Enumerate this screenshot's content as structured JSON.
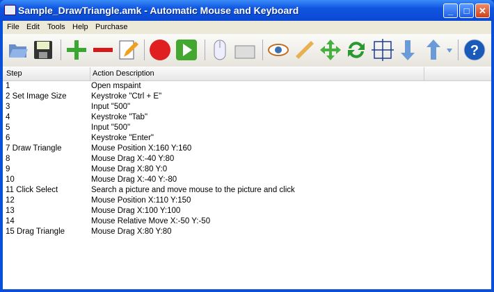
{
  "title": "Sample_DrawTriangle.amk - Automatic Mouse and Keyboard",
  "menu": [
    "File",
    "Edit",
    "Tools",
    "Help",
    "Purchase"
  ],
  "columns": {
    "step": "Step",
    "action": "Action Description"
  },
  "rows": [
    {
      "step": "1",
      "action": "Open mspaint"
    },
    {
      "step": "2  Set Image Size",
      "action": "Keystroke \"Ctrl + E\""
    },
    {
      "step": "3",
      "action": "Input \"500\""
    },
    {
      "step": "4",
      "action": "Keystroke \"Tab\""
    },
    {
      "step": "5",
      "action": "Input \"500\""
    },
    {
      "step": "6",
      "action": "Keystroke \"Enter\""
    },
    {
      "step": "7  Draw Triangle",
      "action": "Mouse Position X:160 Y:160"
    },
    {
      "step": "8",
      "action": "Mouse Drag X:-40 Y:80"
    },
    {
      "step": "9",
      "action": "Mouse Drag X:80 Y:0"
    },
    {
      "step": "10",
      "action": "Mouse Drag X:-40 Y:-80"
    },
    {
      "step": "11  Click Select",
      "action": "Search a picture and move mouse to the picture and click"
    },
    {
      "step": "12",
      "action": "Mouse Position X:110 Y:150"
    },
    {
      "step": "13",
      "action": "Mouse Drag X:100 Y:100"
    },
    {
      "step": "14",
      "action": "Mouse Relative Move X:-50 Y:-50"
    },
    {
      "step": "15  Drag Triangle",
      "action": "Mouse Drag X:80 Y:80"
    }
  ]
}
